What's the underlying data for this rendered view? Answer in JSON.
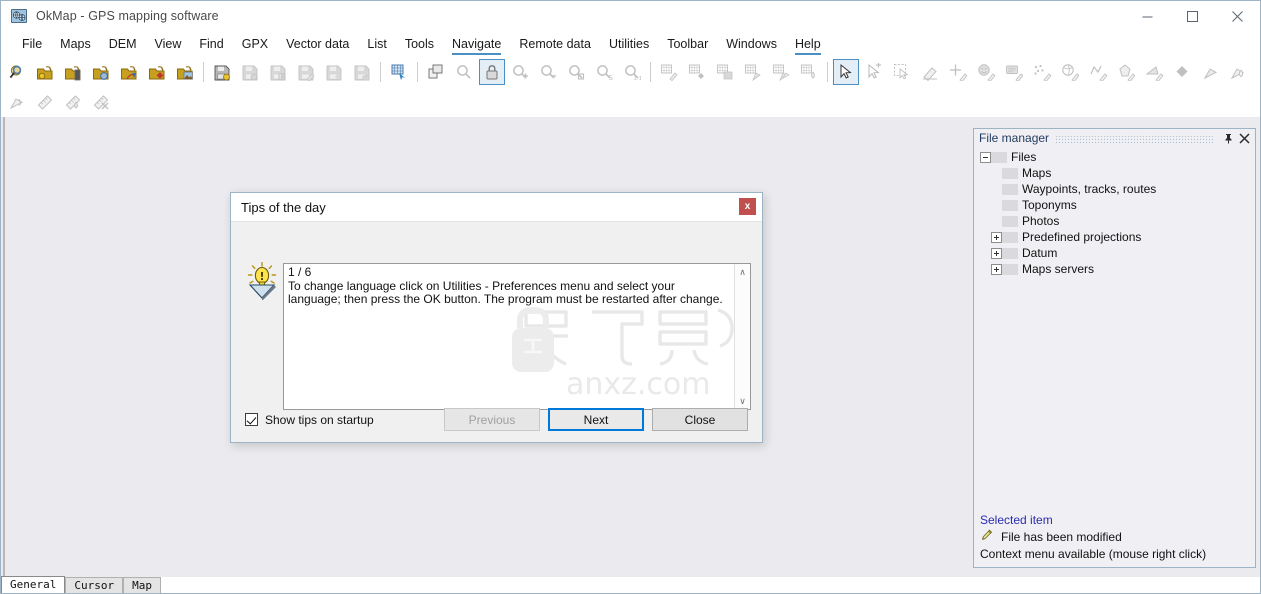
{
  "window": {
    "title": "OkMap - GPS mapping software",
    "app_icon": "okmap-globe-icon",
    "minimize_label": "Minimize",
    "maximize_label": "Maximize",
    "close_label": "Close"
  },
  "menubar": {
    "items": [
      {
        "label": "File",
        "underlined": false
      },
      {
        "label": "Maps",
        "underlined": false
      },
      {
        "label": "DEM",
        "underlined": false
      },
      {
        "label": "View",
        "underlined": false
      },
      {
        "label": "Find",
        "underlined": false
      },
      {
        "label": "GPX",
        "underlined": false
      },
      {
        "label": "Vector data",
        "underlined": false
      },
      {
        "label": "List",
        "underlined": false
      },
      {
        "label": "Tools",
        "underlined": false
      },
      {
        "label": "Navigate",
        "underlined": true
      },
      {
        "label": "Remote data",
        "underlined": false
      },
      {
        "label": "Utilities",
        "underlined": false
      },
      {
        "label": "Toolbar",
        "underlined": false
      },
      {
        "label": "Windows",
        "underlined": false
      },
      {
        "label": "Help",
        "underlined": true
      }
    ]
  },
  "toolbar": {
    "row1": [
      {
        "name": "open-map-search-icon",
        "enabled": true
      },
      {
        "name": "open-folder-waypoint-icon",
        "enabled": true
      },
      {
        "name": "open-folder-device-icon",
        "enabled": true
      },
      {
        "name": "open-folder-settings-icon",
        "enabled": true
      },
      {
        "name": "open-folder-import-icon",
        "enabled": true
      },
      {
        "name": "open-folder-marker-icon",
        "enabled": true
      },
      {
        "name": "open-folder-image-icon",
        "enabled": true
      },
      {
        "name": "separator"
      },
      {
        "name": "save-waypoint-icon",
        "enabled": true
      },
      {
        "name": "save-settings-icon",
        "enabled": false
      },
      {
        "name": "save-grid-icon",
        "enabled": false
      },
      {
        "name": "save-edit-icon",
        "enabled": false
      },
      {
        "name": "save-marker-icon",
        "enabled": false
      },
      {
        "name": "save-device-icon",
        "enabled": false
      },
      {
        "name": "separator"
      },
      {
        "name": "grid-pointer-icon",
        "enabled": true
      },
      {
        "name": "separator"
      },
      {
        "name": "copy-layer-icon",
        "enabled": true
      },
      {
        "name": "zoom-icon",
        "enabled": false
      },
      {
        "name": "lock-zoom-icon",
        "enabled": true,
        "pressed": true
      },
      {
        "name": "zoom-in-icon",
        "enabled": false
      },
      {
        "name": "zoom-out-icon",
        "enabled": false
      },
      {
        "name": "zoom-fit-icon",
        "enabled": false
      },
      {
        "name": "zoom-select-icon",
        "enabled": false
      },
      {
        "name": "zoom-actual-size-icon",
        "enabled": false
      },
      {
        "name": "separator"
      },
      {
        "name": "grid-pencil-icon",
        "enabled": false
      },
      {
        "name": "grid-marker-icon",
        "enabled": false
      },
      {
        "name": "grid-image-icon",
        "enabled": false
      },
      {
        "name": "grid-flag-icon",
        "enabled": false
      },
      {
        "name": "grid-flags-icon",
        "enabled": false
      },
      {
        "name": "grid-drop-icon",
        "enabled": false
      },
      {
        "name": "separator"
      },
      {
        "name": "arrow-select-icon",
        "enabled": true,
        "pressed": true
      },
      {
        "name": "arrow-add-icon",
        "enabled": false
      },
      {
        "name": "marquee-select-icon",
        "enabled": false
      },
      {
        "name": "eraser-icon",
        "enabled": false
      },
      {
        "name": "crosshair-pencil-icon",
        "enabled": false
      },
      {
        "name": "smiley-pencil-icon",
        "enabled": false
      },
      {
        "name": "note-pencil-icon",
        "enabled": false
      },
      {
        "name": "points-pencil-icon",
        "enabled": false
      },
      {
        "name": "circle-pencil-icon",
        "enabled": false
      },
      {
        "name": "polyline-pencil-icon",
        "enabled": false
      },
      {
        "name": "polygon-pencil-icon",
        "enabled": false
      },
      {
        "name": "triangle-pencil-icon",
        "enabled": false
      },
      {
        "name": "diamond-icon",
        "enabled": false
      },
      {
        "name": "flag-icon",
        "enabled": false
      },
      {
        "name": "flag-drop-icon",
        "enabled": false
      }
    ],
    "row2": [
      {
        "name": "flag-cut-icon",
        "enabled": false
      },
      {
        "name": "ruler-icon",
        "enabled": false
      },
      {
        "name": "ruler-drop-icon",
        "enabled": false
      },
      {
        "name": "ruler-delete-icon",
        "enabled": false
      }
    ]
  },
  "file_manager": {
    "title": "File manager",
    "pin_label": "Auto hide",
    "close_label": "Close panel",
    "tree": [
      {
        "label": "Files",
        "level": 0,
        "toggle": "minus"
      },
      {
        "label": "Maps",
        "level": 1,
        "toggle": "none"
      },
      {
        "label": "Waypoints, tracks, routes",
        "level": 1,
        "toggle": "none"
      },
      {
        "label": "Toponyms",
        "level": 1,
        "toggle": "none"
      },
      {
        "label": "Photos",
        "level": 1,
        "toggle": "none"
      },
      {
        "label": "Predefined projections",
        "level": 1,
        "toggle": "plus"
      },
      {
        "label": "Datum",
        "level": 1,
        "toggle": "plus"
      },
      {
        "label": "Maps servers",
        "level": 1,
        "toggle": "plus"
      }
    ],
    "footer": {
      "selected_item_label": "Selected item",
      "modified_icon": "pencil-icon",
      "modified_text": "File has been modified",
      "context_menu_text": "Context menu available (mouse right click)"
    }
  },
  "status_tabs": [
    {
      "label": "General",
      "active": true
    },
    {
      "label": "Cursor",
      "active": false
    },
    {
      "label": "Map",
      "active": false
    }
  ],
  "dialog": {
    "title": "Tips of the day",
    "close_glyph": "x",
    "icon": "lightbulb-tip-icon",
    "counter": "1 / 6",
    "tip_text": "1 / 6\nTo change language click on Utilities - Preferences menu and select your language; then press the OK button. The program must be restarted after change.",
    "scroll_up": "∧",
    "scroll_down": "∨",
    "checkbox_label": "Show tips on startup",
    "checkbox_checked": true,
    "buttons": [
      {
        "label": "Previous",
        "state": "disabled"
      },
      {
        "label": "Next",
        "state": "default"
      },
      {
        "label": "Close",
        "state": "normal"
      }
    ]
  },
  "watermark": {
    "text": "anxz.com",
    "cjk": "安下载",
    "badge_char": "安"
  },
  "colors": {
    "accent": "#0078d7",
    "menu_underline": "#4a90c4",
    "panel_border": "#9cb4c5",
    "dialog_close": "#c0504d",
    "link": "#2a2ab0",
    "canvas": "#ebebef"
  }
}
